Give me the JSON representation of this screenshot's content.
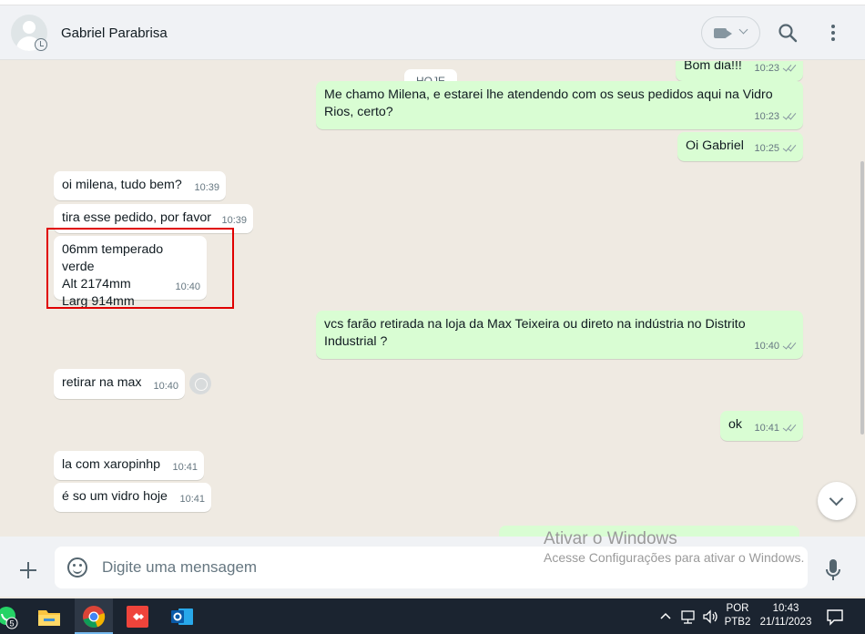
{
  "header": {
    "contact_name": "Gabriel Parabrisa"
  },
  "chat": {
    "date_chip": "HOJE",
    "messages": [
      {
        "dir": "out",
        "text": "Bom dia!!!",
        "time": "10:23",
        "ticks": "double"
      },
      {
        "dir": "out",
        "text": "Me chamo Milena, e estarei lhe atendendo com os seus pedidos aqui na Vidro Rios, certo?",
        "time": "10:23",
        "ticks": "double"
      },
      {
        "dir": "out",
        "text": "Oi Gabriel",
        "time": "10:25",
        "ticks": "double"
      },
      {
        "dir": "in",
        "text": "oi milena, tudo bem?",
        "time": "10:39"
      },
      {
        "dir": "in",
        "text": "tira esse pedido, por favor",
        "time": "10:39"
      },
      {
        "dir": "in",
        "lines": [
          "06mm temperado verde",
          "Alt 2174mm",
          "Larg 914mm"
        ],
        "time": "10:40",
        "highlighted": true
      },
      {
        "dir": "out",
        "text": "vcs farão retirada na loja da Max Teixeira ou direto na indústria no Distrito Industrial ?",
        "time": "10:40",
        "ticks": "double"
      },
      {
        "dir": "in",
        "text": "retirar na max",
        "time": "10:40"
      },
      {
        "dir": "out",
        "text": "ok",
        "time": "10:41",
        "ticks": "double"
      },
      {
        "dir": "in",
        "text": "la com xaropinhp",
        "time": "10:41"
      },
      {
        "dir": "in",
        "text": "é so um vidro hoje",
        "time": "10:41"
      }
    ]
  },
  "watermark": {
    "title": "Ativar o Windows",
    "subtitle": "Acesse Configurações para ativar o Windows."
  },
  "composer": {
    "placeholder": "Digite uma mensagem"
  },
  "taskbar": {
    "whatsapp_badge": "5",
    "language": "POR",
    "keyboard": "PTB2",
    "time": "10:43",
    "date": "21/11/2023"
  },
  "icons": {
    "header": [
      "video-call-icon",
      "search-icon",
      "menu-icon"
    ],
    "composer": [
      "plus-icon",
      "emoji-icon",
      "mic-icon"
    ],
    "taskbar": [
      "whatsapp-icon",
      "file-explorer-icon",
      "chrome-icon",
      "anydesk-icon",
      "outlook-icon",
      "chevron-up-icon",
      "network-icon",
      "volume-icon",
      "notifications-icon"
    ]
  },
  "colors": {
    "incoming_bubble": "#ffffff",
    "outgoing_bubble": "#d9fdd3",
    "chat_background": "#efeae2",
    "highlight_box": "#e00000",
    "taskbar": "#1b2430"
  }
}
